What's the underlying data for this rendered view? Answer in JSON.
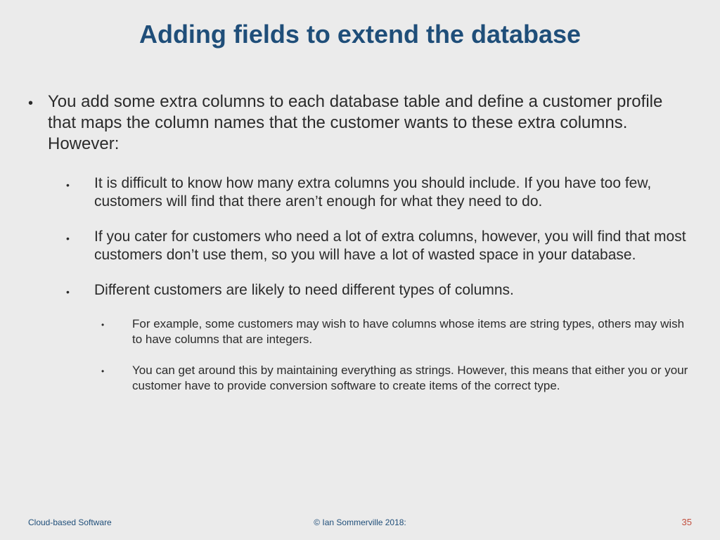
{
  "title": "Adding fields to extend the database",
  "main_point": "You add some extra columns to each database table and define a customer profile that maps the column names that the customer wants to these extra columns. However:",
  "sub_points": [
    "It is difficult to know how many extra columns you should include. If you have too few, customers will find that there aren’t enough for what they need to do.",
    "If you cater for customers who need a lot of extra columns, however, you will find that most customers don’t use them, so you will have a lot of wasted space in your database.",
    "Different customers are likely to need different types of columns."
  ],
  "sub_sub_points": [
    "For example, some customers may wish to have columns whose items are string types, others may wish to have columns that are integers.",
    "You can get around this by maintaining everything as strings. However, this means that either you or your customer have to provide conversion software to create items of the correct type."
  ],
  "footer": {
    "left": "Cloud-based Software",
    "center": "© Ian Sommerville 2018:",
    "page": "35"
  }
}
